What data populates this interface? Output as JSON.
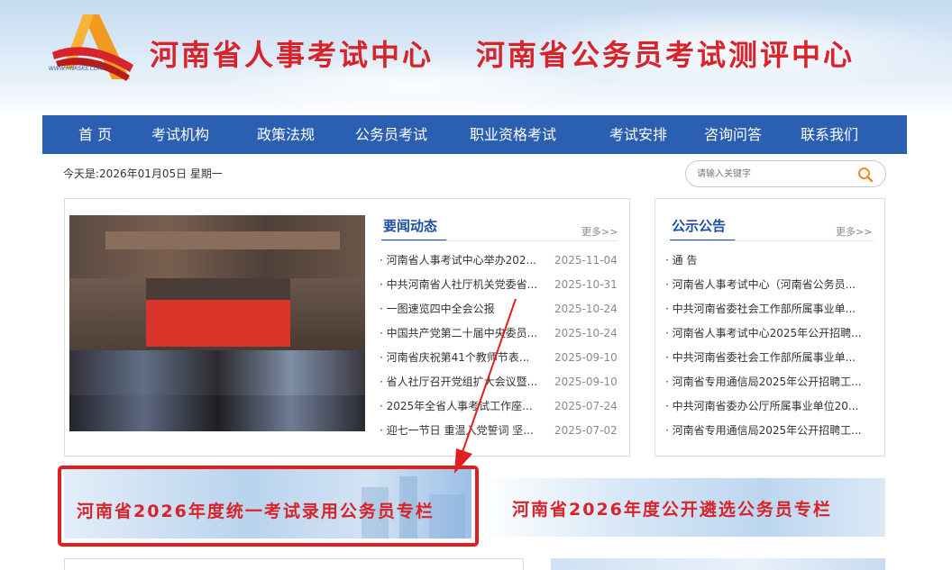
{
  "header": {
    "logo_text": "WWW.HNRSKS.COM",
    "title_1": "河南省人事考试中心",
    "title_2": "河南省公务员考试测评中心"
  },
  "nav": {
    "items": [
      {
        "label": "首 页"
      },
      {
        "label": "考试机构"
      },
      {
        "label": "政策法规"
      },
      {
        "label": "公务员考试"
      },
      {
        "label": "职业资格考试"
      },
      {
        "label": "考试安排"
      },
      {
        "label": "咨询问答"
      },
      {
        "label": "联系我们"
      }
    ]
  },
  "date_text": "今天是:2026年01月05日 星期一",
  "search": {
    "placeholder": "请输入关键字",
    "icon": "search-icon"
  },
  "news": {
    "title": "要闻动态",
    "more": "更多>>",
    "items": [
      {
        "title": "· 河南省人事考试中心举办202...",
        "date": "2025-11-04"
      },
      {
        "title": "· 中共河南省人社厅机关党委省...",
        "date": "2025-10-31"
      },
      {
        "title": "· 一图速览四中全会公报",
        "date": "2025-10-24"
      },
      {
        "title": "· 中国共产党第二十届中央委员...",
        "date": "2025-10-24"
      },
      {
        "title": "· 河南省庆祝第41个教师节表...",
        "date": "2025-09-10"
      },
      {
        "title": "· 省人社厅召开党组扩大会议暨...",
        "date": "2025-09-10"
      },
      {
        "title": "· 2025年全省人事考试工作座...",
        "date": "2025-07-24"
      },
      {
        "title": "· 迎七一节日 重温入党誓词 坚...",
        "date": "2025-07-02"
      }
    ]
  },
  "notices": {
    "title": "公示公告",
    "more": "更多>>",
    "items": [
      {
        "title": "· 通 告"
      },
      {
        "title": "· 河南省人事考试中心（河南省公务员..."
      },
      {
        "title": "· 中共河南省委社会工作部所属事业单..."
      },
      {
        "title": "· 河南省人事考试中心2025年公开招聘..."
      },
      {
        "title": "· 中共河南省委社会工作部所属事业单..."
      },
      {
        "title": "· 河南省专用通信局2025年公开招聘工..."
      },
      {
        "title": "· 中共河南省委办公厅所属事业单位20..."
      },
      {
        "title": "· 河南省专用通信局2025年公开招聘工..."
      }
    ]
  },
  "banners": {
    "left": "河南省2026年度统一考试录用公务员专栏",
    "right": "河南省2026年度公开遴选公务员专栏"
  },
  "colors": {
    "brand_red": "#d8232a",
    "nav_blue": "#2a5fb1",
    "section_blue": "#1f4fa0",
    "annotation_red": "#e02020"
  }
}
